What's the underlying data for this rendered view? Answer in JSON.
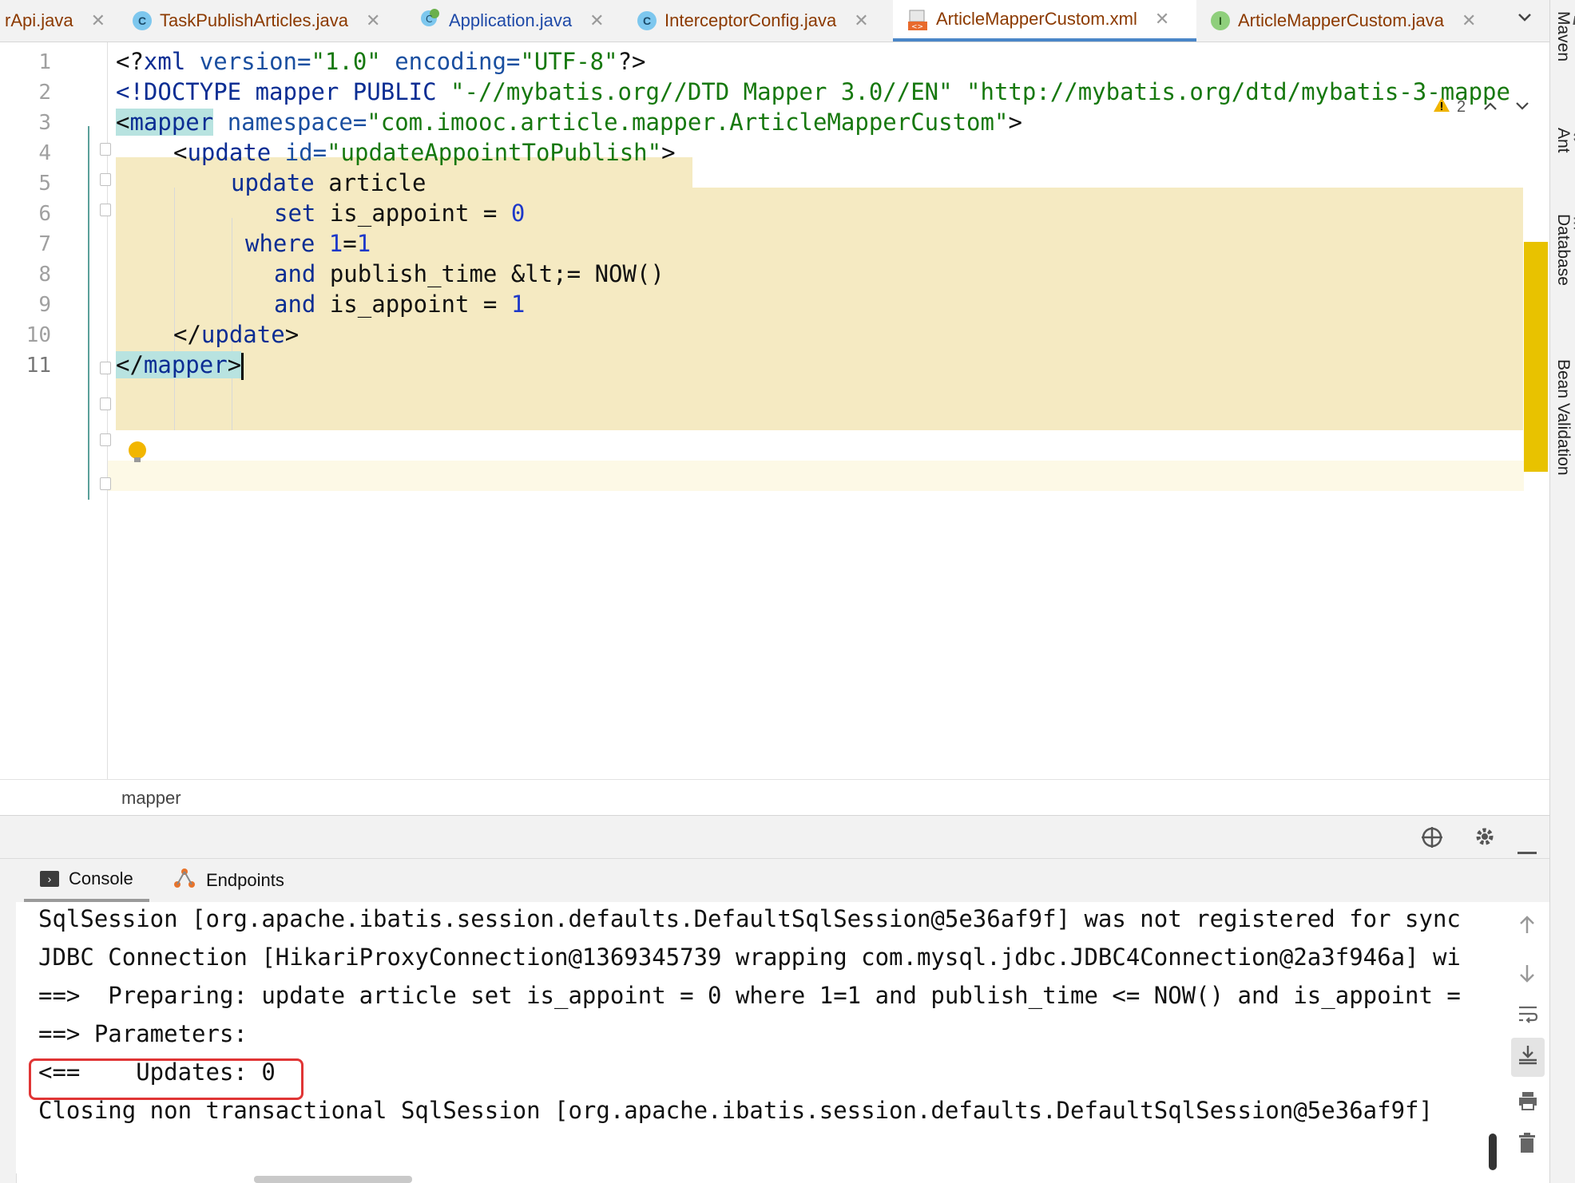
{
  "tabs": [
    {
      "label": "rApi.java",
      "icon": "none"
    },
    {
      "label": "TaskPublishArticles.java",
      "icon": "class-icon"
    },
    {
      "label": "Application.java",
      "icon": "spring-app-icon"
    },
    {
      "label": "InterceptorConfig.java",
      "icon": "class-icon"
    },
    {
      "label": "ArticleMapperCustom.xml",
      "icon": "xml-file-icon",
      "active": true
    },
    {
      "label": "ArticleMapperCustom.java",
      "icon": "interface-icon"
    }
  ],
  "tab_close_glyph": "✕",
  "tab_icon_letters": {
    "class": "C",
    "interface": "I"
  },
  "right_tools": [
    "Maven",
    "Ant",
    "Database",
    "Bean Validation"
  ],
  "editor": {
    "line_numbers": [
      "1",
      "2",
      "3",
      "4",
      "5",
      "6",
      "7",
      "8",
      "9",
      "10",
      "11"
    ],
    "warning_count": "2",
    "lines": {
      "l1": {
        "p1": "<?",
        "p2": "xml",
        "p3": " version=",
        "p4": "\"1.0\"",
        "p5": " encoding=",
        "p6": "\"UTF-8\"",
        "p7": "?>"
      },
      "l2": {
        "p1": "<!DOCTYPE mapper PUBLIC ",
        "p2": "\"-//mybatis.org//DTD Mapper 3.0//EN\"",
        "p3": " ",
        "p4": "\"http://mybatis.org/dtd/mybatis-3-mappe"
      },
      "l3": {
        "p1": "<",
        "p2": "mapper",
        "p3": " namespace=",
        "p4": "\"com.imooc.article.mapper.ArticleMapperCustom\"",
        "p5": ">"
      },
      "l4": {
        "p1": "<",
        "p2": "update",
        "p3": " id=",
        "p4": "\"updateAppointToPublish\"",
        "p5": ">"
      },
      "l5": {
        "p1": "update",
        "p2": " article"
      },
      "l6": {
        "p1": "set",
        "p2": " is_appoint = ",
        "p3": "0"
      },
      "l7": {
        "p1": "where",
        "p2": " ",
        "p3": "1",
        "p4": "=",
        "p5": "1"
      },
      "l8": {
        "p1": "and",
        "p2": " publish_time &lt;= NOW()"
      },
      "l9": {
        "p1": "and",
        "p2": " is_appoint = ",
        "p3": "1"
      },
      "l10": {
        "p1": "</",
        "p2": "update",
        "p3": ">"
      },
      "l11": {
        "p1": "</",
        "p2": "mapper",
        "p3": ">"
      }
    },
    "breadcrumb": "mapper"
  },
  "tool_window": {
    "tabs": [
      {
        "label": "Console"
      },
      {
        "label": "Endpoints"
      }
    ],
    "console_lines": [
      "SqlSession [org.apache.ibatis.session.defaults.DefaultSqlSession@5e36af9f] was not registered for sync",
      "JDBC Connection [HikariProxyConnection@1369345739 wrapping com.mysql.jdbc.JDBC4Connection@2a3f946a] wi",
      "==>  Preparing: update article set is_appoint = 0 where 1=1 and publish_time <= NOW() and is_appoint =",
      "==> Parameters: ",
      "<==    Updates: 0",
      "Closing non transactional SqlSession [org.apache.ibatis.session.defaults.DefaultSqlSession@5e36af9f]"
    ]
  },
  "colors": {
    "highlight_box": "#e03535",
    "active_tab_underline": "#4a86c8",
    "injected_sql_bg": "#f5eac2"
  }
}
